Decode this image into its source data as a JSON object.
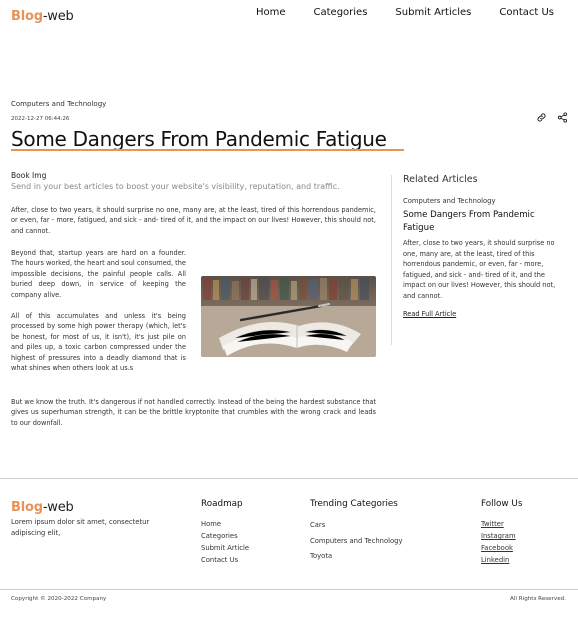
{
  "header": {
    "logo_accent": "Blog",
    "logo_rest": "-web",
    "nav": [
      "Home",
      "Categories",
      "Submit Articles",
      "Contact Us"
    ]
  },
  "article": {
    "category": "Computers and Technology",
    "datetime": "2022-12-27 06:44:26",
    "title": "Some Dangers From Pandemic Fatigue",
    "image_label": "Book Img",
    "subtitle": "Send in your best articles to boost your website's visibility, reputation, and traffic.",
    "paragraphs": [
      "After, close to two years, it should surprise no one, many are, at the least, tired of this horrendous pandemic, or even, far - more, fatigued, and sick - and- tired of it, and the impact on our lives! However, this should not, and cannot.",
      "Beyond that, startup years are hard on a founder. The hours worked, the heart and soul consumed, the impossible decisions, the painful people calls. All buried deep down, in service of keeping the company alive.",
      "All of this accumulates and unless it's being processed by some high power therapy (which, let's be honest, for most of us, it isn't), it's just pile on and piles up, a toxic carbon compressed under the highest of pressures into a deadly diamond that is what shines when others look at us.s",
      "But we know the truth. It's dangerous if not handled correctly. Instead of the being the hardest substance that gives us superhuman strength, it can be the brittle kryptonite that crumbles with the wrong crack and leads to our downfall."
    ]
  },
  "related": {
    "heading": "Related Articles",
    "category": "Computers and Technology",
    "title": "Some Dangers From Pandemic Fatigue",
    "body": "After, close to two years, it should surprise no one, many are, at the least, tired of this horrendous pandemic, or even, far - more, fatigued, and sick - and- tired of it, and the impact on our lives! However, this should not, and cannot.",
    "link": "Read Full Article"
  },
  "footer": {
    "logo_accent": "Blog",
    "logo_rest": "-web",
    "lorem": "Lorem ipsum dolor sit amet, consectetur adipiscing elit,",
    "roadmap": {
      "heading": "Roadmap",
      "items": [
        "Home",
        "Categories",
        "Submit Article",
        "Contact Us"
      ]
    },
    "trending": {
      "heading": "Trending Categories",
      "items": [
        "Cars",
        "Computers and Technology",
        "Toyota"
      ]
    },
    "follow": {
      "heading": "Follow Us",
      "items": [
        "Twitter",
        "Instagram",
        "Facebook",
        "Linkedin"
      ]
    },
    "copyright": "Copyright © 2020-2022 Company",
    "rights": "All Rights Reserved."
  },
  "icons": [
    "link-icon",
    "share-icon"
  ],
  "colors": {
    "accent": "#e8935a",
    "text": "#222222",
    "muted": "#888888"
  }
}
